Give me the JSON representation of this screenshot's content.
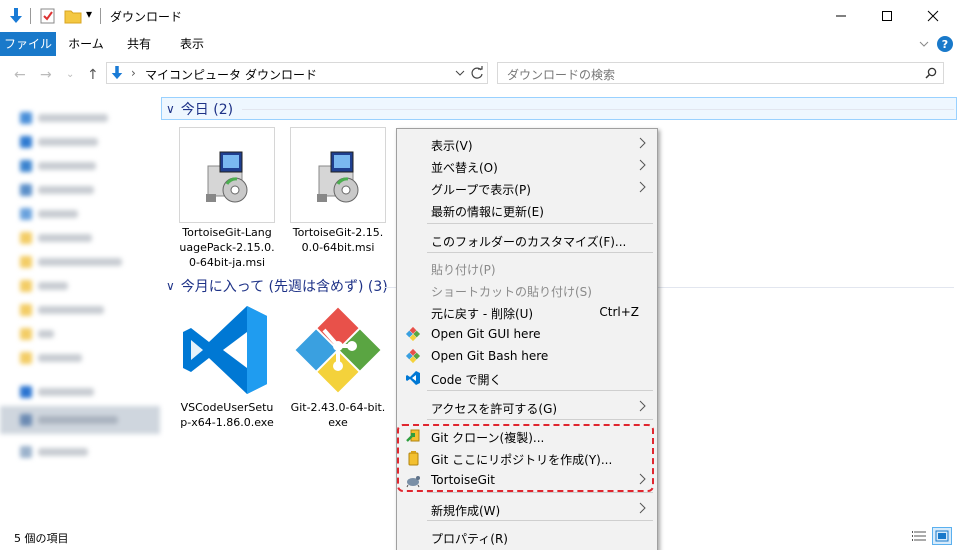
{
  "window": {
    "title": "ダウンロード",
    "quick_access_dropdown": "▾"
  },
  "ribbon": {
    "tabs": [
      "ファイル",
      "ホーム",
      "共有",
      "表示"
    ]
  },
  "address": {
    "crumbs": [
      "マイコンピュータ",
      "ダウンロード"
    ],
    "search_placeholder": "ダウンロードの検索"
  },
  "groups": [
    {
      "title": "今日 (2)"
    },
    {
      "title": "今月に入って (先週は含めず) (3)"
    }
  ],
  "files": [
    {
      "name": "TortoiseGit-LanguagePack-2.15.0.0-64bit-ja.msi",
      "icon": "installer-icon"
    },
    {
      "name": "TortoiseGit-2.15.0.0-64bit.msi",
      "icon": "installer-icon"
    },
    {
      "name": "VSCodeUserSetup-x64-1.86.0.exe",
      "icon": "vscode-icon"
    },
    {
      "name": "Git-2.43.0-64-bit.exe",
      "icon": "git-icon"
    }
  ],
  "context_menu": {
    "items": [
      {
        "label": "表示(V)",
        "submenu": true
      },
      {
        "label": "並べ替え(O)",
        "submenu": true
      },
      {
        "label": "グループで表示(P)",
        "submenu": true
      },
      {
        "label": "最新の情報に更新(E)"
      },
      {
        "label": "このフォルダーのカスタマイズ(F)..."
      },
      {
        "label": "貼り付け(P)",
        "disabled": true
      },
      {
        "label": "ショートカットの貼り付け(S)",
        "disabled": true
      },
      {
        "label": "元に戻す - 削除(U)",
        "accelerator": "Ctrl+Z"
      },
      {
        "label": "Open Git GUI here",
        "icon": "git-gui-icon"
      },
      {
        "label": "Open Git Bash here",
        "icon": "git-bash-icon"
      },
      {
        "label": "Code で開く",
        "icon": "vscode-icon"
      },
      {
        "label": "アクセスを許可する(G)",
        "submenu": true
      },
      {
        "label": "Git クローン(複製)...",
        "icon": "tortoisegit-clone-icon"
      },
      {
        "label": "Git ここにリポジトリを作成(Y)...",
        "icon": "tortoisegit-create-repo-icon"
      },
      {
        "label": "TortoiseGit",
        "icon": "tortoisegit-icon",
        "submenu": true
      },
      {
        "label": "新規作成(W)",
        "submenu": true
      },
      {
        "label": "プロパティ(R)"
      }
    ]
  },
  "status": {
    "item_count": "5 個の項目"
  },
  "colors": {
    "accent": "#1979ca",
    "group_header": "#1e3287",
    "highlight_border": "#e0262f",
    "menu_background": "#f2f2f2"
  }
}
